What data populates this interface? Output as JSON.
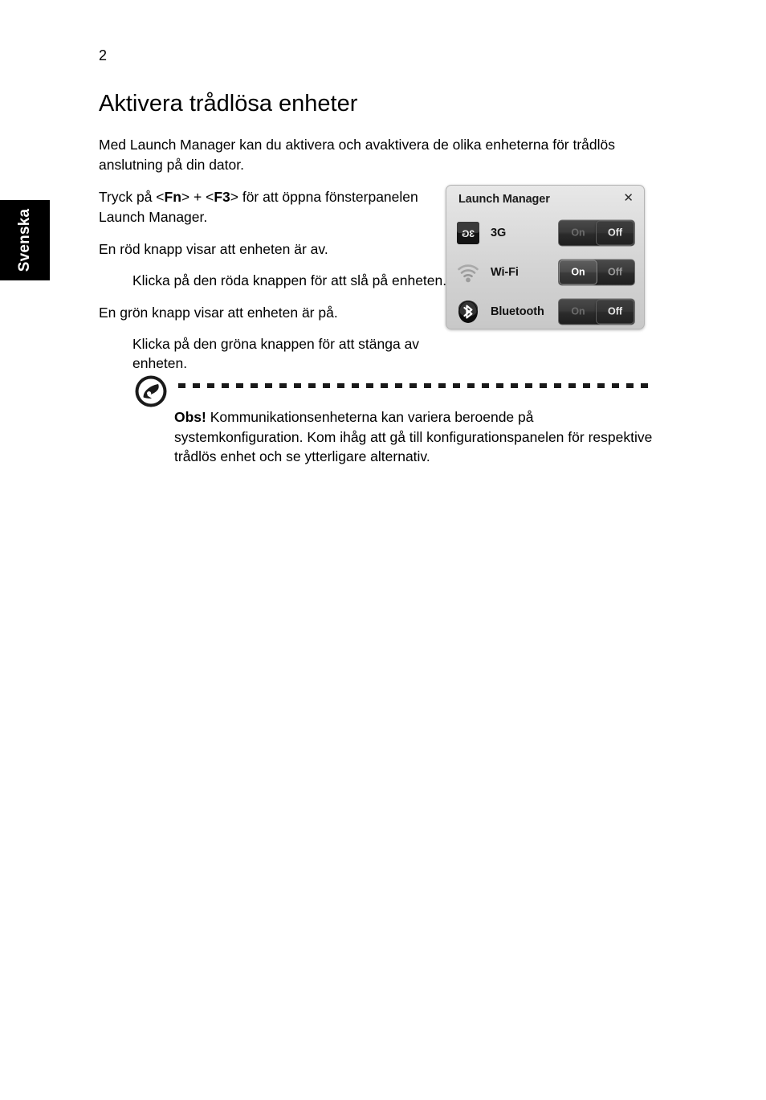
{
  "page": {
    "number": "2",
    "language_tab": "Svenska"
  },
  "content": {
    "title": "Aktivera trådlösa enheter",
    "intro": "Med Launch Manager kan du aktivera och avaktivera de olika enheterna för trådlös anslutning på din dator.",
    "press_prefix": "Tryck på <",
    "key1": "Fn",
    "press_mid": "> + <",
    "key2": "F3",
    "press_suffix": "> för att öppna fönsterpanelen Launch Manager.",
    "red_lead": "En röd knapp visar att enheten är av.",
    "red_detail": "Klicka på den röda knappen för att slå på enheten.",
    "green_lead": "En grön knapp visar att enheten är på.",
    "green_detail": "Klicka på den gröna knappen för att stänga av enheten."
  },
  "note": {
    "icon": "acer-note-icon",
    "lead": "Obs!",
    "text": " Kommunikationsenheterna kan variera beroende på systemkonfiguration. Kom ihåg att gå till konfigurationspanelen för respektive trådlös enhet och se ytterligare alternativ."
  },
  "launch_manager": {
    "title": "Launch Manager",
    "close_label": "✕",
    "rows": [
      {
        "icon": "3g-icon",
        "label": "3G",
        "on_label": "On",
        "off_label": "Off",
        "state": "off",
        "dim": true
      },
      {
        "icon": "wifi-icon",
        "label": "Wi-Fi",
        "on_label": "On",
        "off_label": "Off",
        "state": "on",
        "dim": false
      },
      {
        "icon": "bluetooth-icon",
        "label": "Bluetooth",
        "on_label": "On",
        "off_label": "Off",
        "state": "off",
        "dim": true
      }
    ]
  },
  "colors": {
    "tab_background": "#000000",
    "tab_text": "#ffffff",
    "text": "#000000",
    "dialog_face": "#dedede",
    "toggle_body": "#2b2b2b"
  }
}
